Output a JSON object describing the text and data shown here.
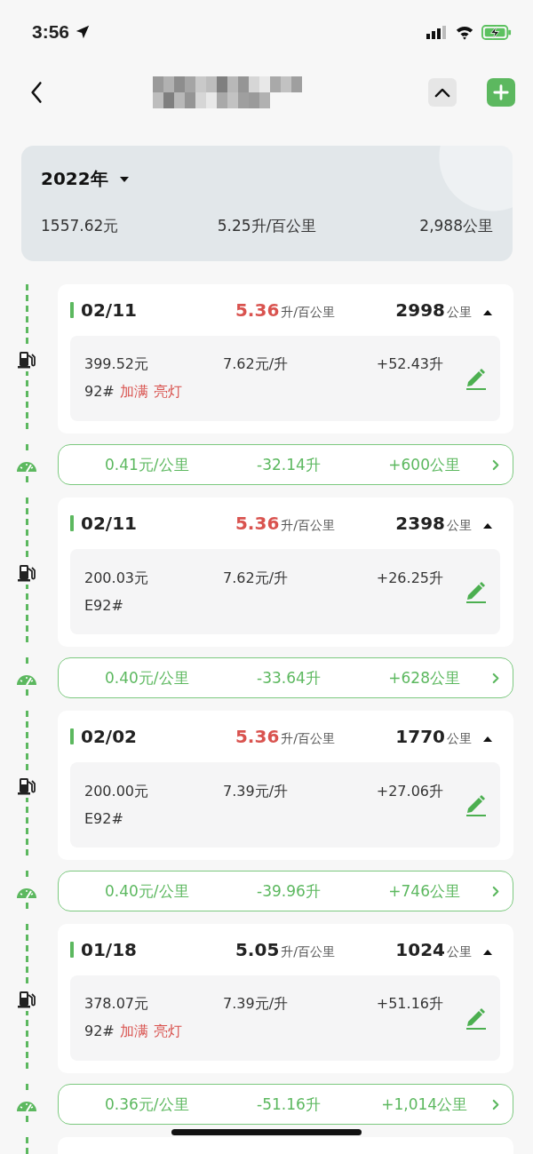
{
  "status_bar": {
    "time": "3:56"
  },
  "summary": {
    "year": "2022年",
    "total_cost": "1557.62元",
    "avg_consumption": "5.25升/百公里",
    "total_distance": "2,988公里"
  },
  "records": [
    {
      "date": "02/11",
      "consumption": "5.36",
      "consumption_unit": "升/百公里",
      "high": true,
      "odometer": "2998",
      "odometer_unit": "公里",
      "expanded": true,
      "cost": "399.52元",
      "price": "7.62元/升",
      "volume": "+52.43升",
      "grade": "92#",
      "tags": [
        "加满",
        "亮灯"
      ],
      "interval": {
        "cost_per_km": "0.41元/公里",
        "fuel_delta": "-32.14升",
        "distance": "+600公里"
      }
    },
    {
      "date": "02/11",
      "consumption": "5.36",
      "consumption_unit": "升/百公里",
      "high": true,
      "odometer": "2398",
      "odometer_unit": "公里",
      "expanded": true,
      "cost": "200.03元",
      "price": "7.62元/升",
      "volume": "+26.25升",
      "grade": "E92#",
      "interval": {
        "cost_per_km": "0.40元/公里",
        "fuel_delta": "-33.64升",
        "distance": "+628公里"
      }
    },
    {
      "date": "02/02",
      "consumption": "5.36",
      "consumption_unit": "升/百公里",
      "high": true,
      "odometer": "1770",
      "odometer_unit": "公里",
      "expanded": true,
      "cost": "200.00元",
      "price": "7.39元/升",
      "volume": "+27.06升",
      "grade": "E92#",
      "interval": {
        "cost_per_km": "0.40元/公里",
        "fuel_delta": "-39.96升",
        "distance": "+746公里"
      }
    },
    {
      "date": "01/18",
      "consumption": "5.05",
      "consumption_unit": "升/百公里",
      "high": false,
      "odometer": "1024",
      "odometer_unit": "公里",
      "expanded": true,
      "cost": "378.07元",
      "price": "7.39元/升",
      "volume": "+51.16升",
      "grade": "92#",
      "tags": [
        "加满",
        "亮灯"
      ],
      "interval": {
        "cost_per_km": "0.36元/公里",
        "fuel_delta": "-51.16升",
        "distance": "+1,014公里"
      }
    }
  ]
}
